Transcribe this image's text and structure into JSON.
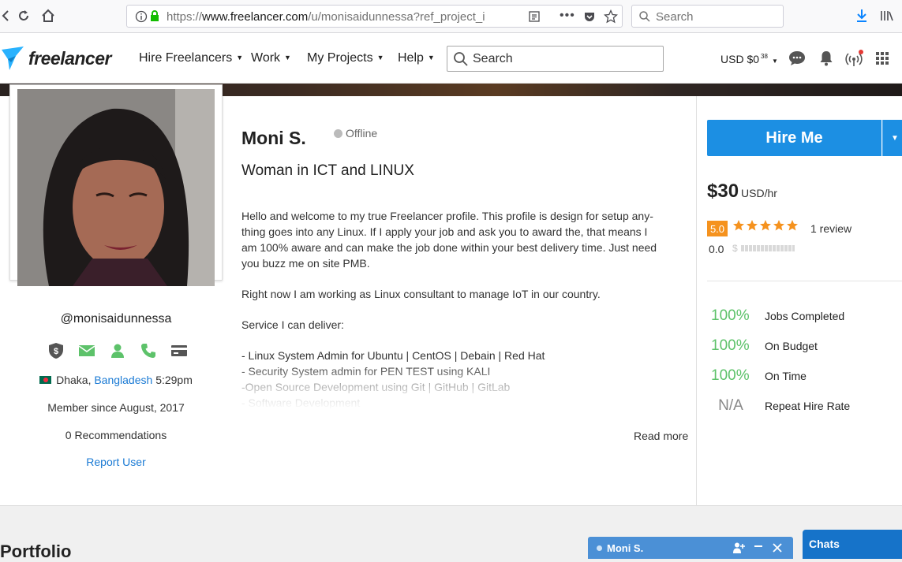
{
  "browser": {
    "url_domain": "www.freelancer.com",
    "url_prefix": "https://",
    "url_path": "/u/monisaidunnessa?ref_project_i",
    "search_placeholder": "Search"
  },
  "header": {
    "logo_text": "freelancer",
    "nav": [
      {
        "label": "Hire Freelancers"
      },
      {
        "label": "Work"
      },
      {
        "label": "My Projects"
      },
      {
        "label": "Help"
      }
    ],
    "search_placeholder": "Search",
    "currency": "USD $0",
    "currency_sup": "38",
    "brand_color": "#29b2fe"
  },
  "profile": {
    "username": "@monisaidunnessa",
    "city": "Dhaka,",
    "country": "Bangladesh",
    "local_time": "5:29pm",
    "member_since": "Member since August, 2017",
    "recommendations": "0 Recommendations",
    "report": "Report User",
    "name": "Moni S.",
    "status": "Offline",
    "tagline": "Woman in ICT and LINUX",
    "description": [
      "Hello and welcome to my true Freelancer profile. This profile is design for setup any-\nthing goes into any Linux. If I apply your job and ask you to award the, that means I\nam 100% aware and can make the job done within your best delivery time. Just need\nyou buzz me on site PMB.",
      "Right now I am working as Linux consultant  to manage IoT in our country.",
      "Service I can deliver:",
      "- Linux System Admin for Ubuntu | CentOS | Debain | Red Hat\n- Security System admin for PEN TEST using KALI\n-Open Source Development using Git | GitHub | GitLab\n- Software Development"
    ],
    "read_more": "Read more",
    "verifications": [
      "payment-verified-icon",
      "email-icon",
      "profile-icon",
      "phone-icon",
      "deposit-icon"
    ],
    "verify_color": "#5dc26a"
  },
  "sidebar": {
    "hire_label": "Hire Me",
    "rate": "$30",
    "rate_unit": "USD/hr",
    "score": "5.0",
    "stars": 5,
    "reviews": "1 review",
    "earnings_score": "0.0",
    "stats": [
      {
        "pct": "100%",
        "label": "Jobs Completed"
      },
      {
        "pct": "100%",
        "label": "On Budget"
      },
      {
        "pct": "100%",
        "label": "On Time"
      },
      {
        "pct": "N/A",
        "label": "Repeat Hire Rate"
      }
    ]
  },
  "portfolio_heading": "Portfolio",
  "chat": {
    "window_name": "Moni S.",
    "tab_label": "Chats"
  }
}
